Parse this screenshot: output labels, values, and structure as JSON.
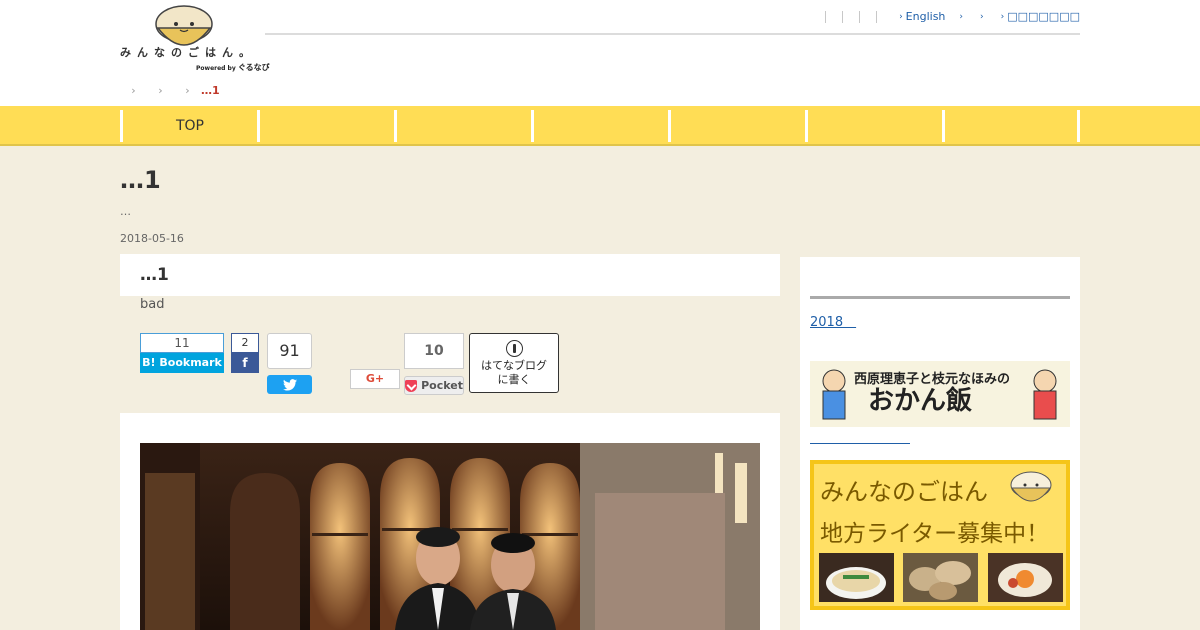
{
  "header": {
    "logo_text": "みんなのごはん。",
    "logo_powered": "Powered by",
    "logo_gnavi": "ぐるなび",
    "top_links": [
      "English",
      "",
      "",
      "□□□□□□□"
    ]
  },
  "breadcrumb": {
    "current": "…1"
  },
  "nav": {
    "items": [
      "TOP",
      "",
      "",
      "",
      "",
      "",
      "",
      ""
    ]
  },
  "main": {
    "title": "…1",
    "subtitle": "…",
    "date": "2018-05-16",
    "article_heading": "…1",
    "article_text": "bad"
  },
  "share": {
    "hatena_count": "11",
    "hatena_label": "B! Bookmark",
    "facebook_count": "2",
    "facebook_label": "f",
    "twitter_count": "91",
    "googleplus_label": "G+",
    "pocket_count": "10",
    "pocket_label": "Pocket",
    "hatenablog_label_1": "はてなブログ",
    "hatenablog_label_2": "に書く"
  },
  "sidebar": {
    "archive_link": "2018　",
    "banner1_text": "西原理恵子と枝元なほみの",
    "banner1_title": "おかん飯",
    "banner2_line1": "みんなのごはん",
    "banner2_line2": "地方ライター募集中！"
  },
  "colors": {
    "nav_bg": "#ffdd55",
    "page_bg": "#f3eedf",
    "link": "#1f5fa8",
    "accent_red": "#c0392b"
  }
}
